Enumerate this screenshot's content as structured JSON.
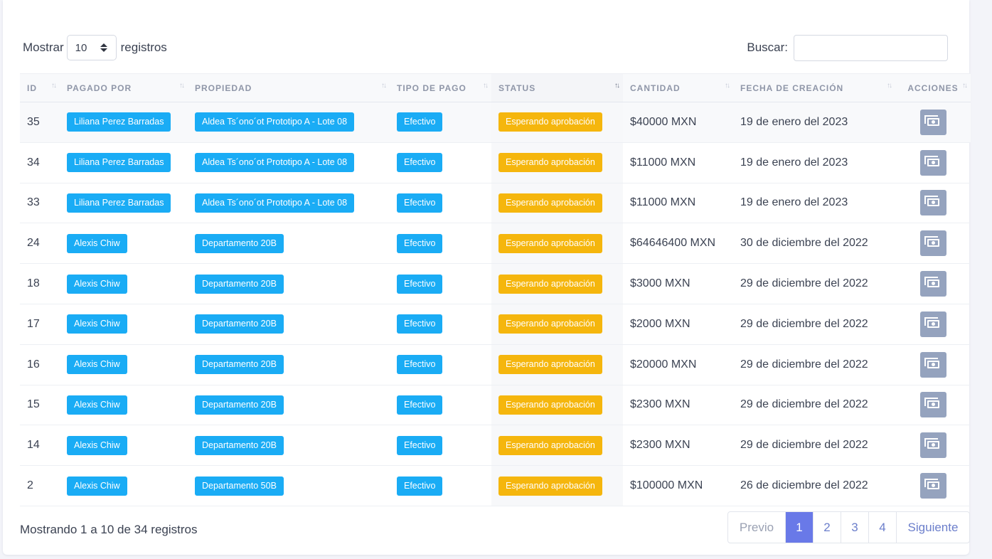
{
  "length_menu": {
    "prefix": "Mostrar",
    "value": "10",
    "suffix": "registros"
  },
  "search": {
    "label": "Buscar:",
    "value": ""
  },
  "columns": [
    "ID",
    "PAGADO POR",
    "PROPIEDAD",
    "TIPO DE PAGO",
    "STATUS",
    "CANTIDAD",
    "FECHA DE CREACIÓN",
    "ACCIONES"
  ],
  "rows": [
    {
      "id": "35",
      "payer": "Liliana Perez Barradas",
      "property": "Aldea Ts´ono´ot Prototipo A - Lote 08",
      "payment_type": "Efectivo",
      "status": "Esperando aprobación",
      "amount": "$40000 MXN",
      "date": "19 de enero del 2023"
    },
    {
      "id": "34",
      "payer": "Liliana Perez Barradas",
      "property": "Aldea Ts´ono´ot Prototipo A - Lote 08",
      "payment_type": "Efectivo",
      "status": "Esperando aprobación",
      "amount": "$11000 MXN",
      "date": "19 de enero del 2023"
    },
    {
      "id": "33",
      "payer": "Liliana Perez Barradas",
      "property": "Aldea Ts´ono´ot Prototipo A - Lote 08",
      "payment_type": "Efectivo",
      "status": "Esperando aprobación",
      "amount": "$11000 MXN",
      "date": "19 de enero del 2023"
    },
    {
      "id": "24",
      "payer": "Alexis Chiw",
      "property": "Departamento 20B",
      "payment_type": "Efectivo",
      "status": "Esperando aprobación",
      "amount": "$64646400 MXN",
      "date": "30 de diciembre del 2022"
    },
    {
      "id": "18",
      "payer": "Alexis Chiw",
      "property": "Departamento 20B",
      "payment_type": "Efectivo",
      "status": "Esperando aprobación",
      "amount": "$3000 MXN",
      "date": "29 de diciembre del 2022"
    },
    {
      "id": "17",
      "payer": "Alexis Chiw",
      "property": "Departamento 20B",
      "payment_type": "Efectivo",
      "status": "Esperando aprobación",
      "amount": "$2000 MXN",
      "date": "29 de diciembre del 2022"
    },
    {
      "id": "16",
      "payer": "Alexis Chiw",
      "property": "Departamento 20B",
      "payment_type": "Efectivo",
      "status": "Esperando aprobación",
      "amount": "$20000 MXN",
      "date": "29 de diciembre del 2022"
    },
    {
      "id": "15",
      "payer": "Alexis Chiw",
      "property": "Departamento 20B",
      "payment_type": "Efectivo",
      "status": "Esperando aprobación",
      "amount": "$2300 MXN",
      "date": "29 de diciembre del 2022"
    },
    {
      "id": "14",
      "payer": "Alexis Chiw",
      "property": "Departamento 20B",
      "payment_type": "Efectivo",
      "status": "Esperando aprobación",
      "amount": "$2300 MXN",
      "date": "29 de diciembre del 2022"
    },
    {
      "id": "2",
      "payer": "Alexis Chiw",
      "property": "Departamento 50B",
      "payment_type": "Efectivo",
      "status": "Esperando aprobación",
      "amount": "$100000 MXN",
      "date": "26 de diciembre del 2022"
    }
  ],
  "action_icon": "money-icon",
  "info_text": "Mostrando 1 a 10 de 34 registros",
  "pagination": {
    "prev": "Previo",
    "pages": [
      "1",
      "2",
      "3",
      "4"
    ],
    "current": "1",
    "next": "Siguiente"
  },
  "colors": {
    "badge_blue": "#1aacf5",
    "badge_yellow": "#f5b60d",
    "action_button": "#95a3be",
    "pager_active": "#6979e8"
  }
}
